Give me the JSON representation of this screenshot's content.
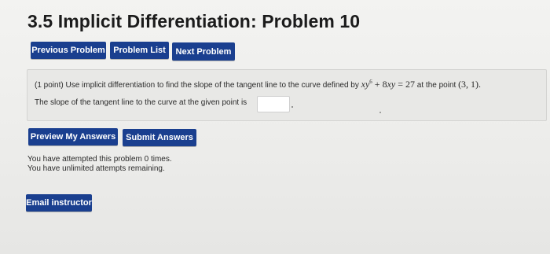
{
  "page": {
    "title": "3.5 Implicit Differentiation: Problem 10"
  },
  "nav": {
    "previous_label": "Previous Problem",
    "list_label": "Problem List",
    "next_label": "Next Problem"
  },
  "problem": {
    "points": "(1 point)",
    "prompt": "Use implicit differentiation to find the slope of the tangent line to the curve defined by",
    "equation": {
      "x": "x",
      "y": "y",
      "exponent": "6",
      "plus_term": "+ 8",
      "x2": "x",
      "y2": "y",
      "equals": "= 27"
    },
    "at_point_text": "at the point",
    "point": "(3, 1).",
    "slope_text": "The slope of the tangent line to the curve at the given point is",
    "answer_value": ""
  },
  "actions": {
    "preview_label": "Preview My Answers",
    "submit_label": "Submit Answers"
  },
  "status": {
    "attempts_line": "You have attempted this problem 0 times.",
    "remaining_line": "You have unlimited attempts remaining."
  },
  "footer": {
    "email_label": "Email instructor"
  },
  "colors": {
    "button_bg": "#1a3f8f",
    "button_text": "#ffffff",
    "panel_bg": "#e8e8e6"
  }
}
